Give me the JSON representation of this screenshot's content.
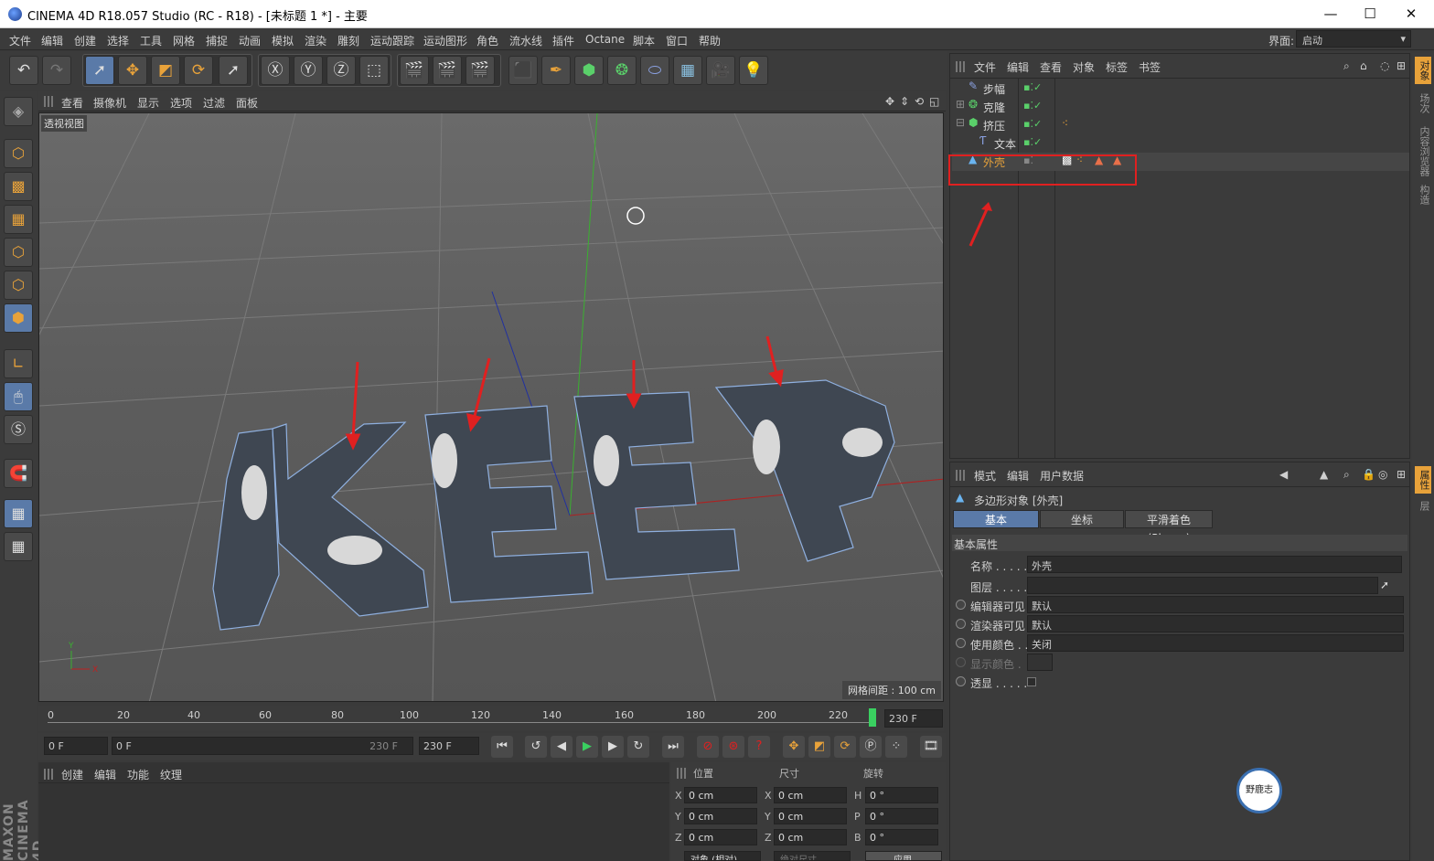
{
  "window": {
    "title": "CINEMA 4D R18.057 Studio (RC - R18) - [未标题 1 *] - 主要",
    "minimize": "—",
    "maximize": "☐",
    "close": "✕"
  },
  "menu": [
    "文件",
    "编辑",
    "创建",
    "选择",
    "工具",
    "网格",
    "捕捉",
    "动画",
    "模拟",
    "渲染",
    "雕刻",
    "运动跟踪",
    "运动图形",
    "角色",
    "流水线",
    "插件",
    "Octane",
    "脚本",
    "窗口",
    "帮助"
  ],
  "layout": {
    "label": "界面:",
    "value": "启动"
  },
  "viewport_menu": [
    "查看",
    "摄像机",
    "显示",
    "选项",
    "过滤",
    "面板"
  ],
  "viewport": {
    "label": "透视视图",
    "grid_info": "网格间距 : 100 cm",
    "text_3d": "KEEP"
  },
  "timeline": {
    "ticks": [
      "0",
      "20",
      "40",
      "60",
      "80",
      "100",
      "120",
      "140",
      "160",
      "180",
      "200",
      "220"
    ],
    "end": "230 F"
  },
  "transport": {
    "current": "0 F",
    "range_start": "0 F",
    "range_end": "230 F",
    "max": "230 F"
  },
  "material_menu": [
    "创建",
    "编辑",
    "功能",
    "纹理"
  ],
  "coords": {
    "headers": [
      "位置",
      "尺寸",
      "旋转"
    ],
    "rows": [
      {
        "a": "X",
        "av": "0 cm",
        "b": "X",
        "bv": "0 cm",
        "c": "H",
        "cv": "0 °"
      },
      {
        "a": "Y",
        "av": "0 cm",
        "b": "Y",
        "bv": "0 cm",
        "c": "P",
        "cv": "0 °"
      },
      {
        "a": "Z",
        "av": "0 cm",
        "b": "Z",
        "bv": "0 cm",
        "c": "B",
        "cv": "0 °"
      }
    ],
    "mode": "对象 (相对)",
    "size_mode": "绝对尺寸",
    "apply": "应用"
  },
  "object_menu": [
    "文件",
    "编辑",
    "查看",
    "对象",
    "标签",
    "书签"
  ],
  "objects": [
    {
      "name": "步幅",
      "icon": "✎"
    },
    {
      "name": "克隆",
      "icon": "❂"
    },
    {
      "name": "挤压",
      "icon": "⬢"
    },
    {
      "name": "文本",
      "icon": "Ƭ"
    },
    {
      "name": "外壳",
      "icon": "▲"
    }
  ],
  "attr_menu": [
    "模式",
    "编辑",
    "用户数据"
  ],
  "attr": {
    "title": "多边形对象 [外壳]",
    "tabs": [
      "基本",
      "坐标",
      "平滑着色(Phong)"
    ],
    "section": "基本属性",
    "props": [
      {
        "label": "名称 . . . . .",
        "value": "外壳"
      },
      {
        "label": "图层 . . . . .",
        "value": ""
      },
      {
        "label": "编辑器可见",
        "value": "默认"
      },
      {
        "label": "渲染器可见",
        "value": "默认"
      },
      {
        "label": "使用颜色 . .",
        "value": "关闭"
      },
      {
        "label": "显示颜色 .",
        "value": ""
      },
      {
        "label": "透显 . . . . .",
        "value": ""
      }
    ]
  },
  "right_tabs_top": [
    "对象",
    "场次",
    "内容浏览器",
    "构造"
  ],
  "right_tabs_bottom": [
    "属性",
    "层"
  ],
  "brand": "MAXON CINEMA 4D",
  "watermark": "野鹿志",
  "colors": {
    "accent": "#e8a23a",
    "highlight": "#5a7aa8",
    "red": "#e02020"
  }
}
